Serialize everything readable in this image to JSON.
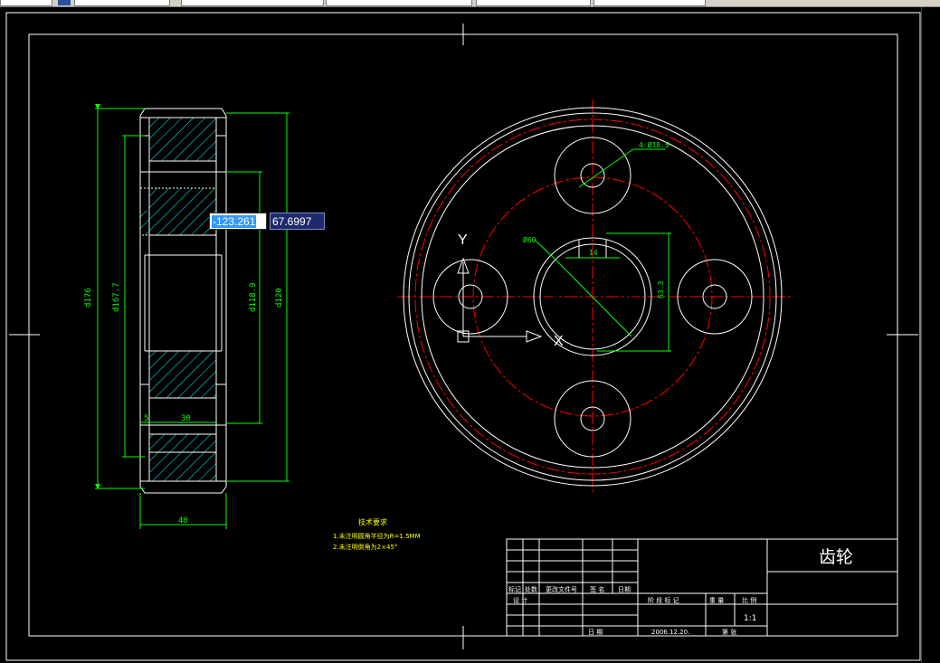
{
  "toolbar": {
    "fields": [
      "",
      "",
      "",
      "",
      ""
    ]
  },
  "dynamic_input": {
    "x_value": "-123.261",
    "y_value": "67.6997"
  },
  "drawing": {
    "colors": {
      "outline": "#ffffff",
      "dimension": "#00ff00",
      "centerline": "#ff0000",
      "hatch": "#00ffff",
      "title_text": "#ffffff",
      "notes_text": "#ffff00"
    },
    "side_view": {
      "dim_outer": "d176",
      "dim_pitch": "d167.7",
      "dim_bore_a": "d118.9",
      "dim_bore_b": "d120",
      "dim_width": "40",
      "dim_slot_a": "5",
      "dim_slot_b": "30"
    },
    "front_view": {
      "hole_label": "4-Ø18.5",
      "bore_label": "Ø60",
      "keyway_width": "14",
      "keyway_depth": "63.3",
      "ucs_y": "Y",
      "ucs_x": "X"
    },
    "notes": {
      "title": "技术要求",
      "line1": "1.未注明圆角半径为R=1.5MM",
      "line2": "2.未注明倒角为2×45°"
    },
    "title_block": {
      "part_name": "齿轮",
      "scale_value": "1:1",
      "header": [
        "标记",
        "处数",
        "更改文件号",
        "签 名",
        "日期"
      ],
      "design": "设 计",
      "stage_mark": "阶 段 标 记",
      "weight": "重 量",
      "scale": "比 例",
      "date_label": "日 期",
      "date_value": "2006.12.20.",
      "sheet": "第    张"
    }
  }
}
